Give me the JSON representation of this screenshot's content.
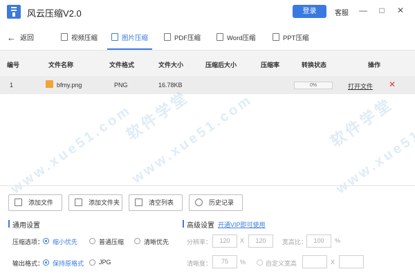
{
  "app": {
    "title": "风云压缩V2.0",
    "login_label": "登录",
    "service_label": "客服",
    "minimize_glyph": "—",
    "maximize_glyph": "□",
    "close_glyph": "✕",
    "brand_color": "#3a7ae0"
  },
  "nav": {
    "back_label": "返回",
    "tabs": [
      {
        "label": "视频压缩",
        "icon": "video-file-icon",
        "active": false
      },
      {
        "label": "图片压缩",
        "icon": "image-file-icon",
        "active": true
      },
      {
        "label": "PDF压缩",
        "icon": "pdf-file-icon",
        "active": false
      },
      {
        "label": "Word压缩",
        "icon": "word-file-icon",
        "active": false
      },
      {
        "label": "PPT压缩",
        "icon": "ppt-file-icon",
        "active": false
      }
    ]
  },
  "table": {
    "headers": [
      "编号",
      "文件名称",
      "文件格式",
      "文件大小",
      "压缩后大小",
      "压缩率",
      "转换状态",
      "操作"
    ],
    "rows": [
      {
        "index": "1",
        "name": "bfmy.png",
        "format": "PNG",
        "size": "16.78KB",
        "compressed_size": "",
        "ratio": "",
        "status": "0%",
        "progress": 0,
        "action_open": "打开文件",
        "action_delete": "✕"
      }
    ]
  },
  "watermark": {
    "text1": "软件学堂",
    "text2": "www.xue51.com"
  },
  "actions": {
    "add_file": "添加文件",
    "add_folder": "添加文件夹",
    "clear_list": "清空列表",
    "history": "历史记录"
  },
  "general": {
    "title": "通用设置",
    "compress_label": "压缩选项：",
    "compress_options": [
      "缩小优先",
      "普通压缩",
      "清晰优先"
    ],
    "compress_selected": 0,
    "output_label": "输出格式：",
    "output_options": [
      "保持原格式",
      "JPG"
    ],
    "output_selected": 0
  },
  "advanced": {
    "title": "高级设置",
    "vip_link": "开通VIP即可使用",
    "resolution_label": "分辨率：",
    "width_value": "120",
    "x_sep": "X",
    "height_value": "120",
    "aspect_label": "宽高比：",
    "aspect_value": "100",
    "percent": "%",
    "clarity_label": "清晰度：",
    "clarity_value": "75",
    "custom_label": "自定义宽高",
    "custom_width": "",
    "custom_height": ""
  }
}
